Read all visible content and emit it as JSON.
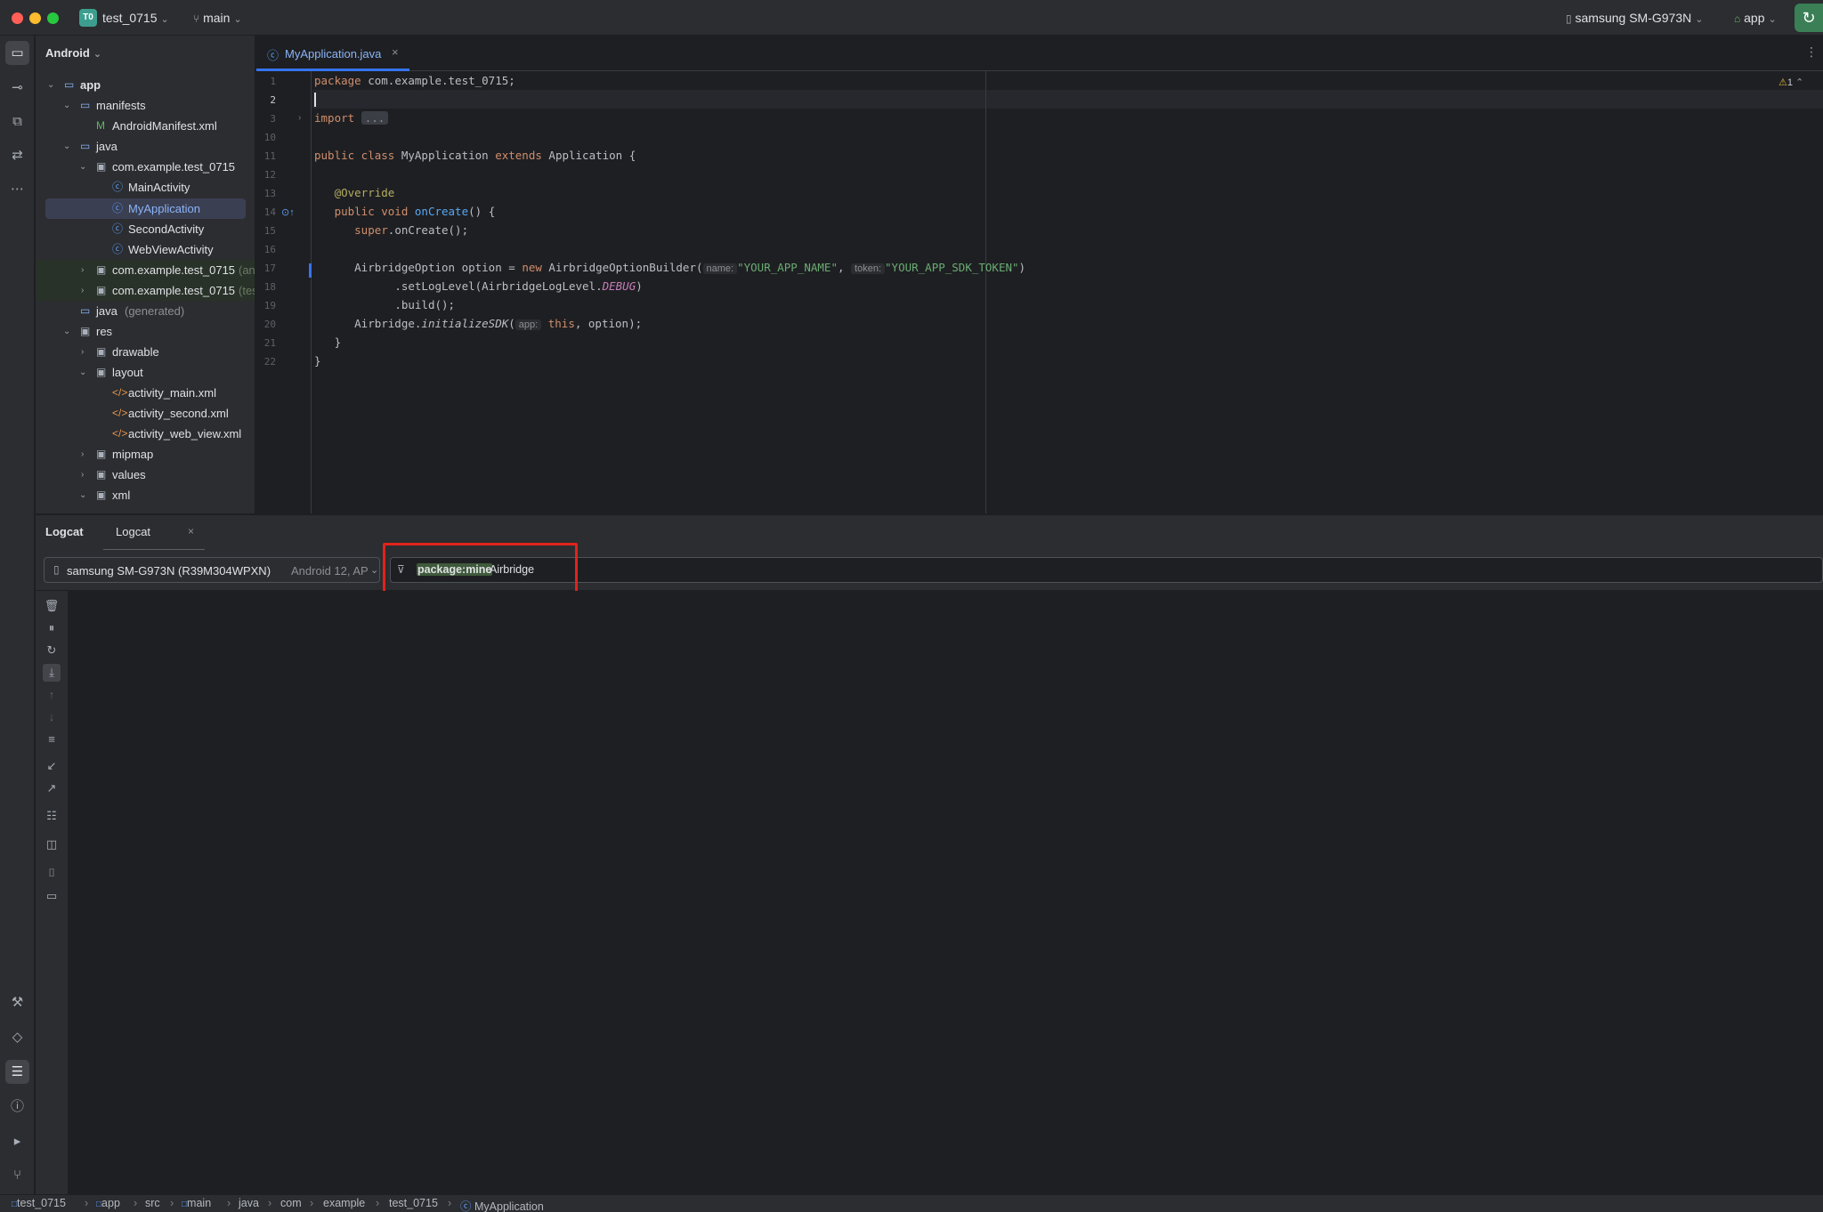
{
  "titlebar": {
    "project_badge": "T0",
    "project_name": "test_0715",
    "branch": "main",
    "device": "samsung SM-G973N",
    "run_config": "app"
  },
  "project_panel": {
    "view_mode": "Android",
    "tree": {
      "app": "app",
      "manifests": "manifests",
      "manifest_file": "AndroidManifest.xml",
      "java": "java",
      "pkg_main": "com.example.test_0715",
      "class_main_activity": "MainActivity",
      "class_my_application": "MyApplication",
      "class_second_activity": "SecondActivity",
      "class_webview_activity": "WebViewActivity",
      "pkg_android_test": "com.example.test_0715",
      "pkg_android_test_suffix": "(an",
      "pkg_test": "com.example.test_0715",
      "pkg_test_suffix": "(tes",
      "java_generated": "java",
      "java_generated_suffix": "(generated)",
      "res": "res",
      "drawable": "drawable",
      "layout": "layout",
      "layout_main": "activity_main.xml",
      "layout_second": "activity_second.xml",
      "layout_web_view": "activity_web_view.xml",
      "mipmap": "mipmap",
      "values": "values",
      "xml": "xml"
    }
  },
  "editor": {
    "tab_label": "MyApplication.java",
    "warnings_count": "1",
    "line_numbers": [
      "1",
      "2",
      "3",
      "10",
      "11",
      "12",
      "13",
      "14",
      "15",
      "16",
      "17",
      "18",
      "19",
      "20",
      "21",
      "22"
    ],
    "code": {
      "l1_kw": "package",
      "l1_rest": " com.example.test_0715;",
      "l3_kw": "import",
      "l3_fold": "...",
      "l11_kw1": "public class",
      "l11_name": " MyApplication ",
      "l11_kw2": "extends",
      "l11_rest": " Application {",
      "l13_ann": "@Override",
      "l14_kw": "public void",
      "l14_fn": "onCreate",
      "l14_rest": "() {",
      "l15_kw": "super",
      "l15_rest": ".onCreate();",
      "l17_a": "AirbridgeOption option = ",
      "l17_kw": "new",
      "l17_b": " AirbridgeOptionBuilder(",
      "l17_hint1": "name:",
      "l17_str1": "\"YOUR_APP_NAME\"",
      "l17_comma": ", ",
      "l17_hint2": "token:",
      "l17_str2": "\"YOUR_APP_SDK_TOKEN\"",
      "l17_end": ")",
      "l18_a": ".setLogLevel(AirbridgeLogLevel.",
      "l18_cst": "DEBUG",
      "l18_end": ")",
      "l19": ".build();",
      "l20_a": "Airbridge.",
      "l20_it": "initializeSDK",
      "l20_b": "(",
      "l20_hint": "app:",
      "l20_kw": "this",
      "l20_end": ", option);",
      "l21": "}",
      "l22": "}"
    }
  },
  "logcat": {
    "panel_title": "Logcat",
    "tab_label": "Logcat",
    "device_label": "samsung SM-G973N (R39M304WPXN)",
    "device_sub": "Android 12, AP",
    "filter_token": "package:mine",
    "filter_text": "Airbridge"
  },
  "statusbar": {
    "crumbs": [
      "test_0715",
      "app",
      "src",
      "main",
      "java",
      "com",
      "example",
      "test_0715",
      "MyApplication"
    ]
  },
  "colors": {
    "accent": "#3574f0",
    "highlight_box": "#e0231b",
    "sync_button": "#3a7f56"
  }
}
